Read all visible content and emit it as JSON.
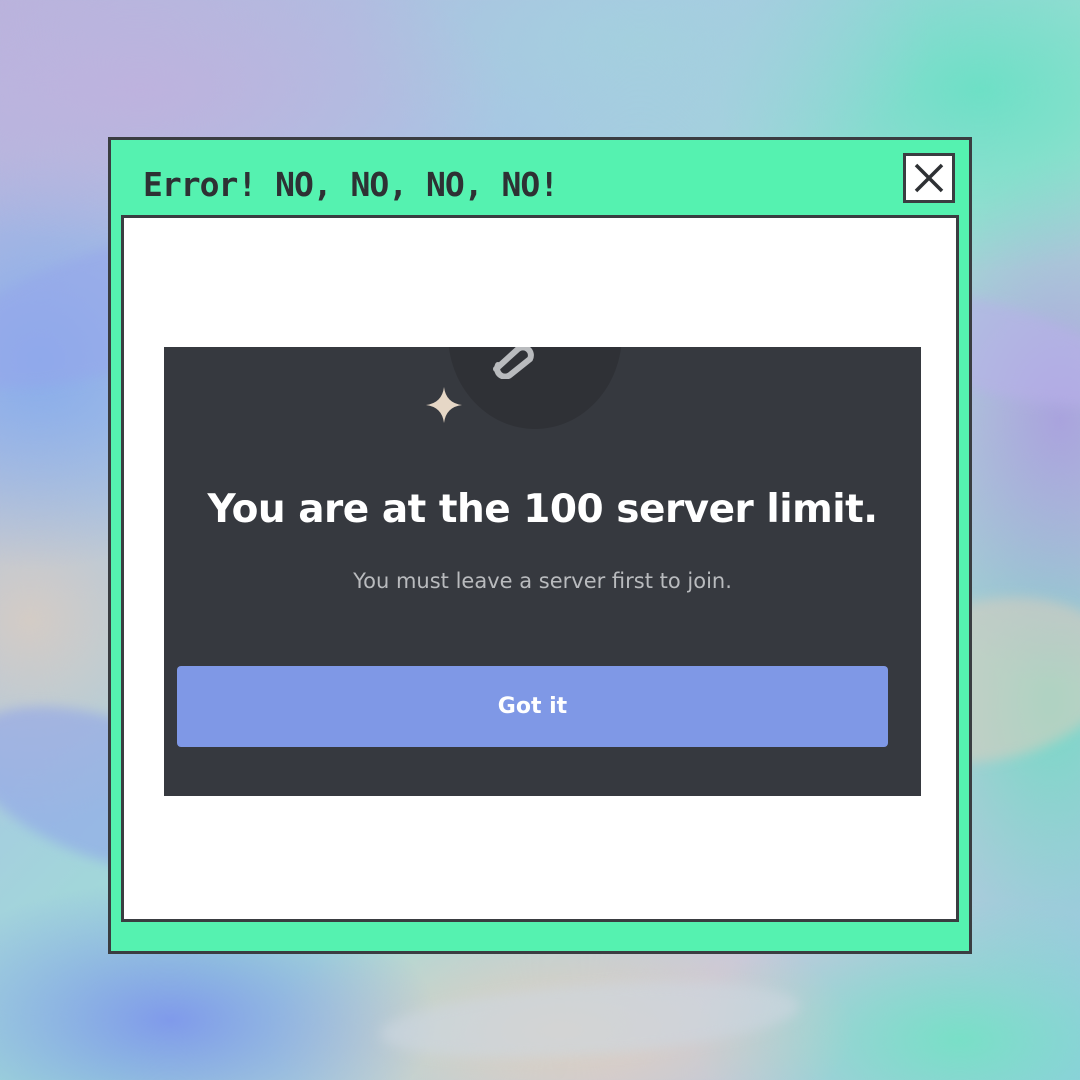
{
  "window": {
    "title": "Error! NO, NO, NO, NO!",
    "close_icon": "close-icon",
    "frame_color": "#55f2b0",
    "border_color": "#3a3d41"
  },
  "modal": {
    "icon": "link-icon",
    "decoration_icon": "sparkle-icon",
    "title": "You are at the 100 server limit.",
    "subtitle": "You must leave a server first to join.",
    "button_label": "Got it",
    "background_color": "#36393f",
    "button_color": "#7f98e6"
  }
}
